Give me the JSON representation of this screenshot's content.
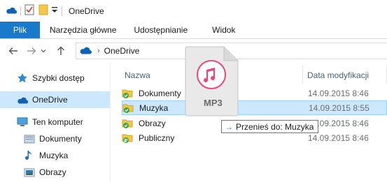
{
  "window": {
    "title": "OneDrive"
  },
  "quick_access_toolbar": {
    "icons": [
      "onedrive-cloud-icon",
      "properties-icon",
      "new-folder-icon",
      "dropdown-icon"
    ]
  },
  "ribbon": {
    "tabs": [
      {
        "label": "Plik",
        "active": true
      },
      {
        "label": "Narzędzia główne"
      },
      {
        "label": "Udostępnianie"
      },
      {
        "label": "Widok"
      }
    ]
  },
  "address_bar": {
    "breadcrumb": [
      "OneDrive"
    ]
  },
  "nav_pane": {
    "items": [
      {
        "label": "Szybki dostęp",
        "icon": "star-icon"
      },
      {
        "label": "OneDrive",
        "icon": "onedrive-cloud-icon",
        "selected": true
      },
      {
        "label": "Ten komputer",
        "icon": "computer-icon"
      },
      {
        "label": "Dokumenty",
        "icon": "documents-icon"
      },
      {
        "label": "Muzyka",
        "icon": "music-note-icon"
      },
      {
        "label": "Obrazy",
        "icon": "pictures-icon"
      }
    ]
  },
  "file_list": {
    "columns": {
      "name": "Nazwa",
      "modified": "Data modyfikacji"
    },
    "rows": [
      {
        "name": "Dokumenty",
        "modified": "14.09.2015 8:46",
        "status": "synced"
      },
      {
        "name": "Muzyka",
        "modified": "14.09.2015 8:55",
        "status": "synced",
        "highlighted": true
      },
      {
        "name": "Obrazy",
        "modified": "14.09.2015 8:46",
        "status": "synced"
      },
      {
        "name": "Publiczny",
        "modified": "14.09.2015 8:46",
        "status": "shared"
      }
    ]
  },
  "drag": {
    "file_label": "MP3",
    "tooltip": "Przenieś do: Muzyka"
  },
  "colors": {
    "file_tab": "#1979ca",
    "selection": "#cce8ff",
    "selection_border": "#99d1ff",
    "onedrive_blue": "#0f62b3",
    "sync_green": "#3aa845",
    "folder_yellow": "#f3c748",
    "itunes_pink": "#f0447c"
  }
}
